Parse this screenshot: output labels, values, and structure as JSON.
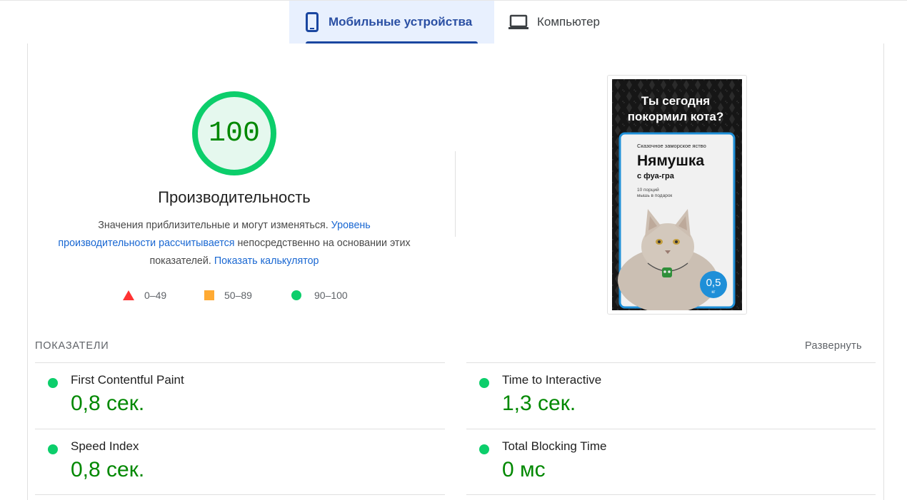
{
  "tabs": {
    "mobile": {
      "label": "Мобильные устройства",
      "icon": "smartphone-icon"
    },
    "desktop": {
      "label": "Компьютер",
      "icon": "laptop-icon"
    }
  },
  "score": {
    "value": "100",
    "fraction": 1.0,
    "title": "Производительность",
    "color": "#0cce6b",
    "text_color": "#008800"
  },
  "description": {
    "part1": "Значения приблизительные и могут изменяться. ",
    "link1": "Уровень производительности рассчитывается",
    "part2": " непосредственно на основании этих показателей. ",
    "link2": "Показать калькулятор"
  },
  "legend": [
    {
      "range": "0–49",
      "shape": "triangle",
      "color": "#ff3333"
    },
    {
      "range": "50–89",
      "shape": "square",
      "color": "#ffaa33"
    },
    {
      "range": "90–100",
      "shape": "circle",
      "color": "#0cce6b"
    }
  ],
  "screenshot": {
    "headline_1": "Ты сегодня",
    "headline_2": "покормил кота?",
    "subtitle": "Сказочное заморское яство",
    "brand": "Нямушка",
    "flavor": "с фуа-гра",
    "note_1": "10 порций",
    "note_2": "мышь в подарок",
    "weight": "0,5",
    "unit": "кг"
  },
  "metrics": {
    "heading": "ПОКАЗАТЕЛИ",
    "expand_label": "Развернуть",
    "items": [
      {
        "name": "First Contentful Paint",
        "value": "0,8 сек."
      },
      {
        "name": "Time to Interactive",
        "value": "1,3 сек."
      },
      {
        "name": "Speed Index",
        "value": "0,8 сек."
      },
      {
        "name": "Total Blocking Time",
        "value": "0 мс"
      }
    ]
  }
}
